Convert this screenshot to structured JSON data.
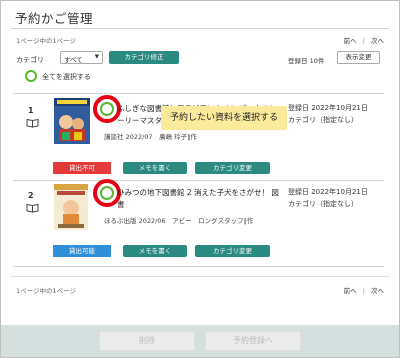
{
  "page": {
    "title": "予約かご管理"
  },
  "pager": {
    "info": "1ページ中の1ページ",
    "prev": "前へ",
    "next": "次へ"
  },
  "toolbar": {
    "category_label": "カテゴリ",
    "category_value": "すべて",
    "category_fix_button": "カテゴリ修正",
    "registered_count": "登録日 10件",
    "display_change_button": "表示変更",
    "select_all_label": "全てを選択する"
  },
  "items": [
    {
      "num": "1",
      "title": "ふしぎな図書館とアラビアンナイト ブックストーリーマスターズ 2",
      "meta": "講談社 2022/07　廣嶋 玲子∥作",
      "reg_date": "登録日 2022年10月21日",
      "category": "カテゴリ（指定なし）",
      "status": "貸出不可",
      "status_color": "#e33a3a",
      "memo_button": "メモを書く",
      "category_button": "カテゴリ変更"
    },
    {
      "num": "2",
      "title": "ひみつの地下図書館 2 消えた子犬をさがせ！ 図書",
      "meta": "ほるぷ出版 2022/06　アビー　ロングスタッフ∥作",
      "reg_date": "登録日 2022年10月21日",
      "category": "カテゴリ（指定なし）",
      "status": "貸出可能",
      "status_color": "#2f8fd8",
      "memo_button": "メモを書く",
      "category_button": "カテゴリ変更"
    }
  ],
  "tooltip": "予約したい資料を選択する",
  "footer": {
    "delete_button": "削除",
    "reserve_button": "予約登録へ"
  },
  "colors": {
    "accent_teal": "#2c8b80",
    "check_green": "#5cb531",
    "highlight_red": "#e60012",
    "tooltip_yellow": "#fbea9b"
  }
}
